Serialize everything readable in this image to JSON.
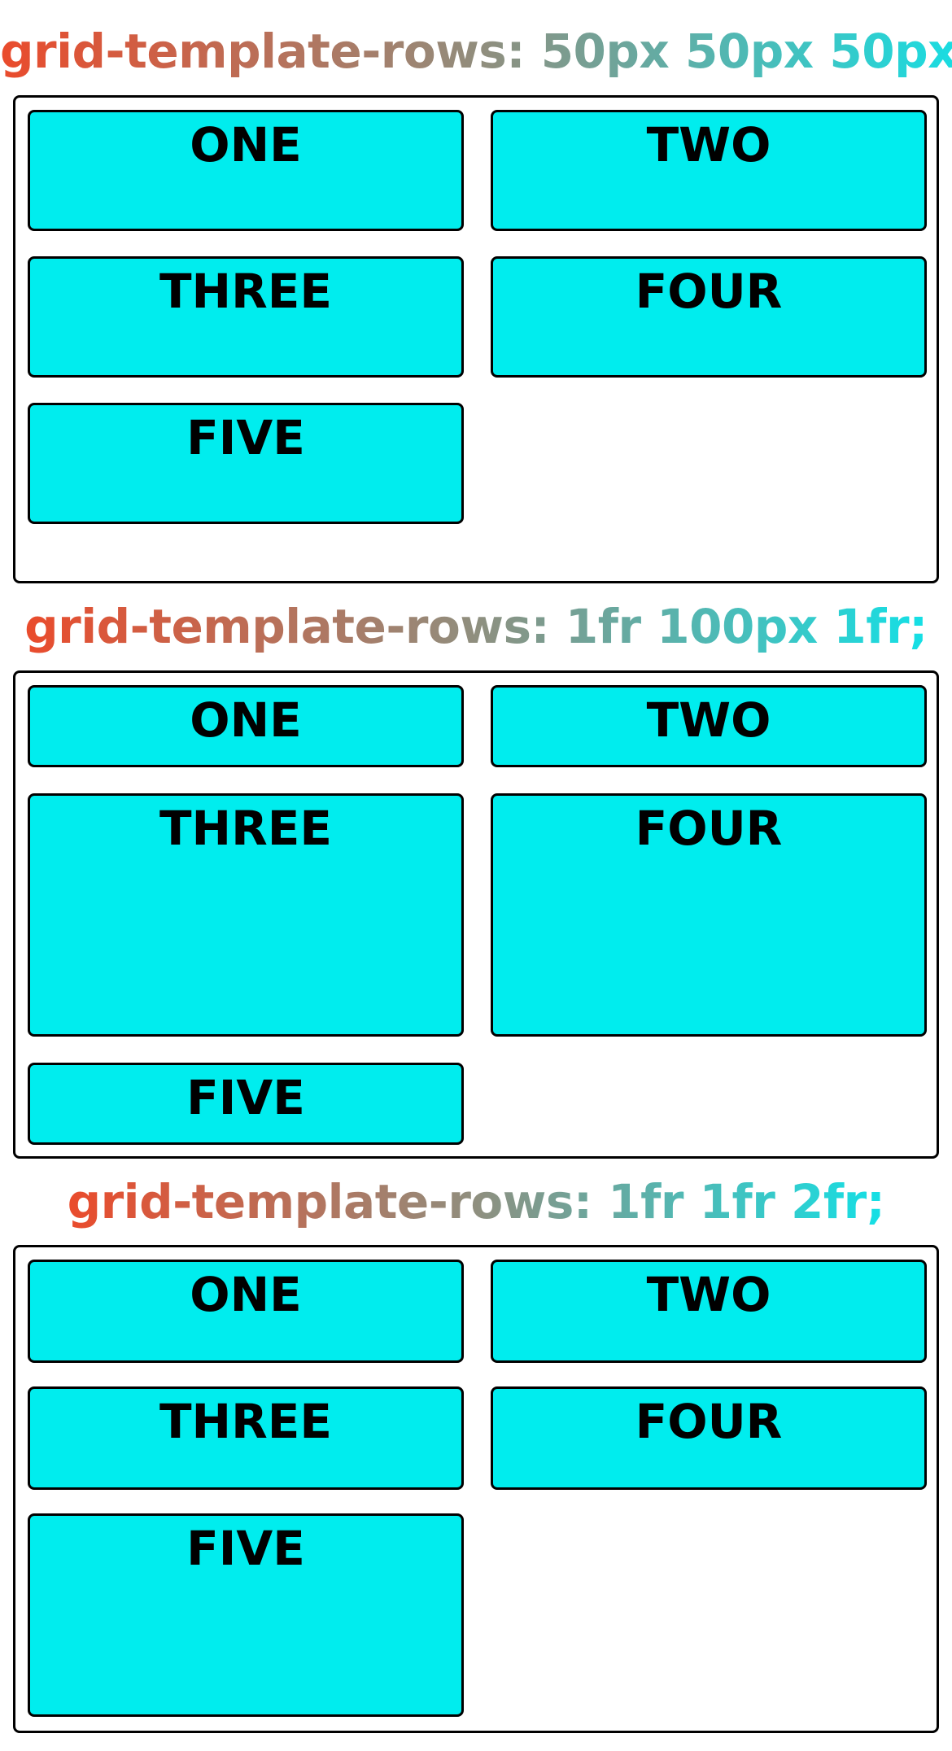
{
  "colors": {
    "cell_background": "#00edee",
    "border": "#000000",
    "heading_gradient_start": "#ea4b2c",
    "heading_gradient_mid": "#8f8f7f",
    "heading_gradient_end": "#14e0e6"
  },
  "sections": [
    {
      "heading": "grid-template-rows: 50px 50px 50px;",
      "cells": [
        "ONE",
        "TWO",
        "THREE",
        "FOUR",
        "FIVE"
      ]
    },
    {
      "heading": "grid-template-rows: 1fr 100px 1fr;",
      "cells": [
        "ONE",
        "TWO",
        "THREE",
        "FOUR",
        "FIVE"
      ]
    },
    {
      "heading": "grid-template-rows: 1fr 1fr 2fr;",
      "cells": [
        "ONE",
        "TWO",
        "THREE",
        "FOUR",
        "FIVE"
      ]
    }
  ]
}
